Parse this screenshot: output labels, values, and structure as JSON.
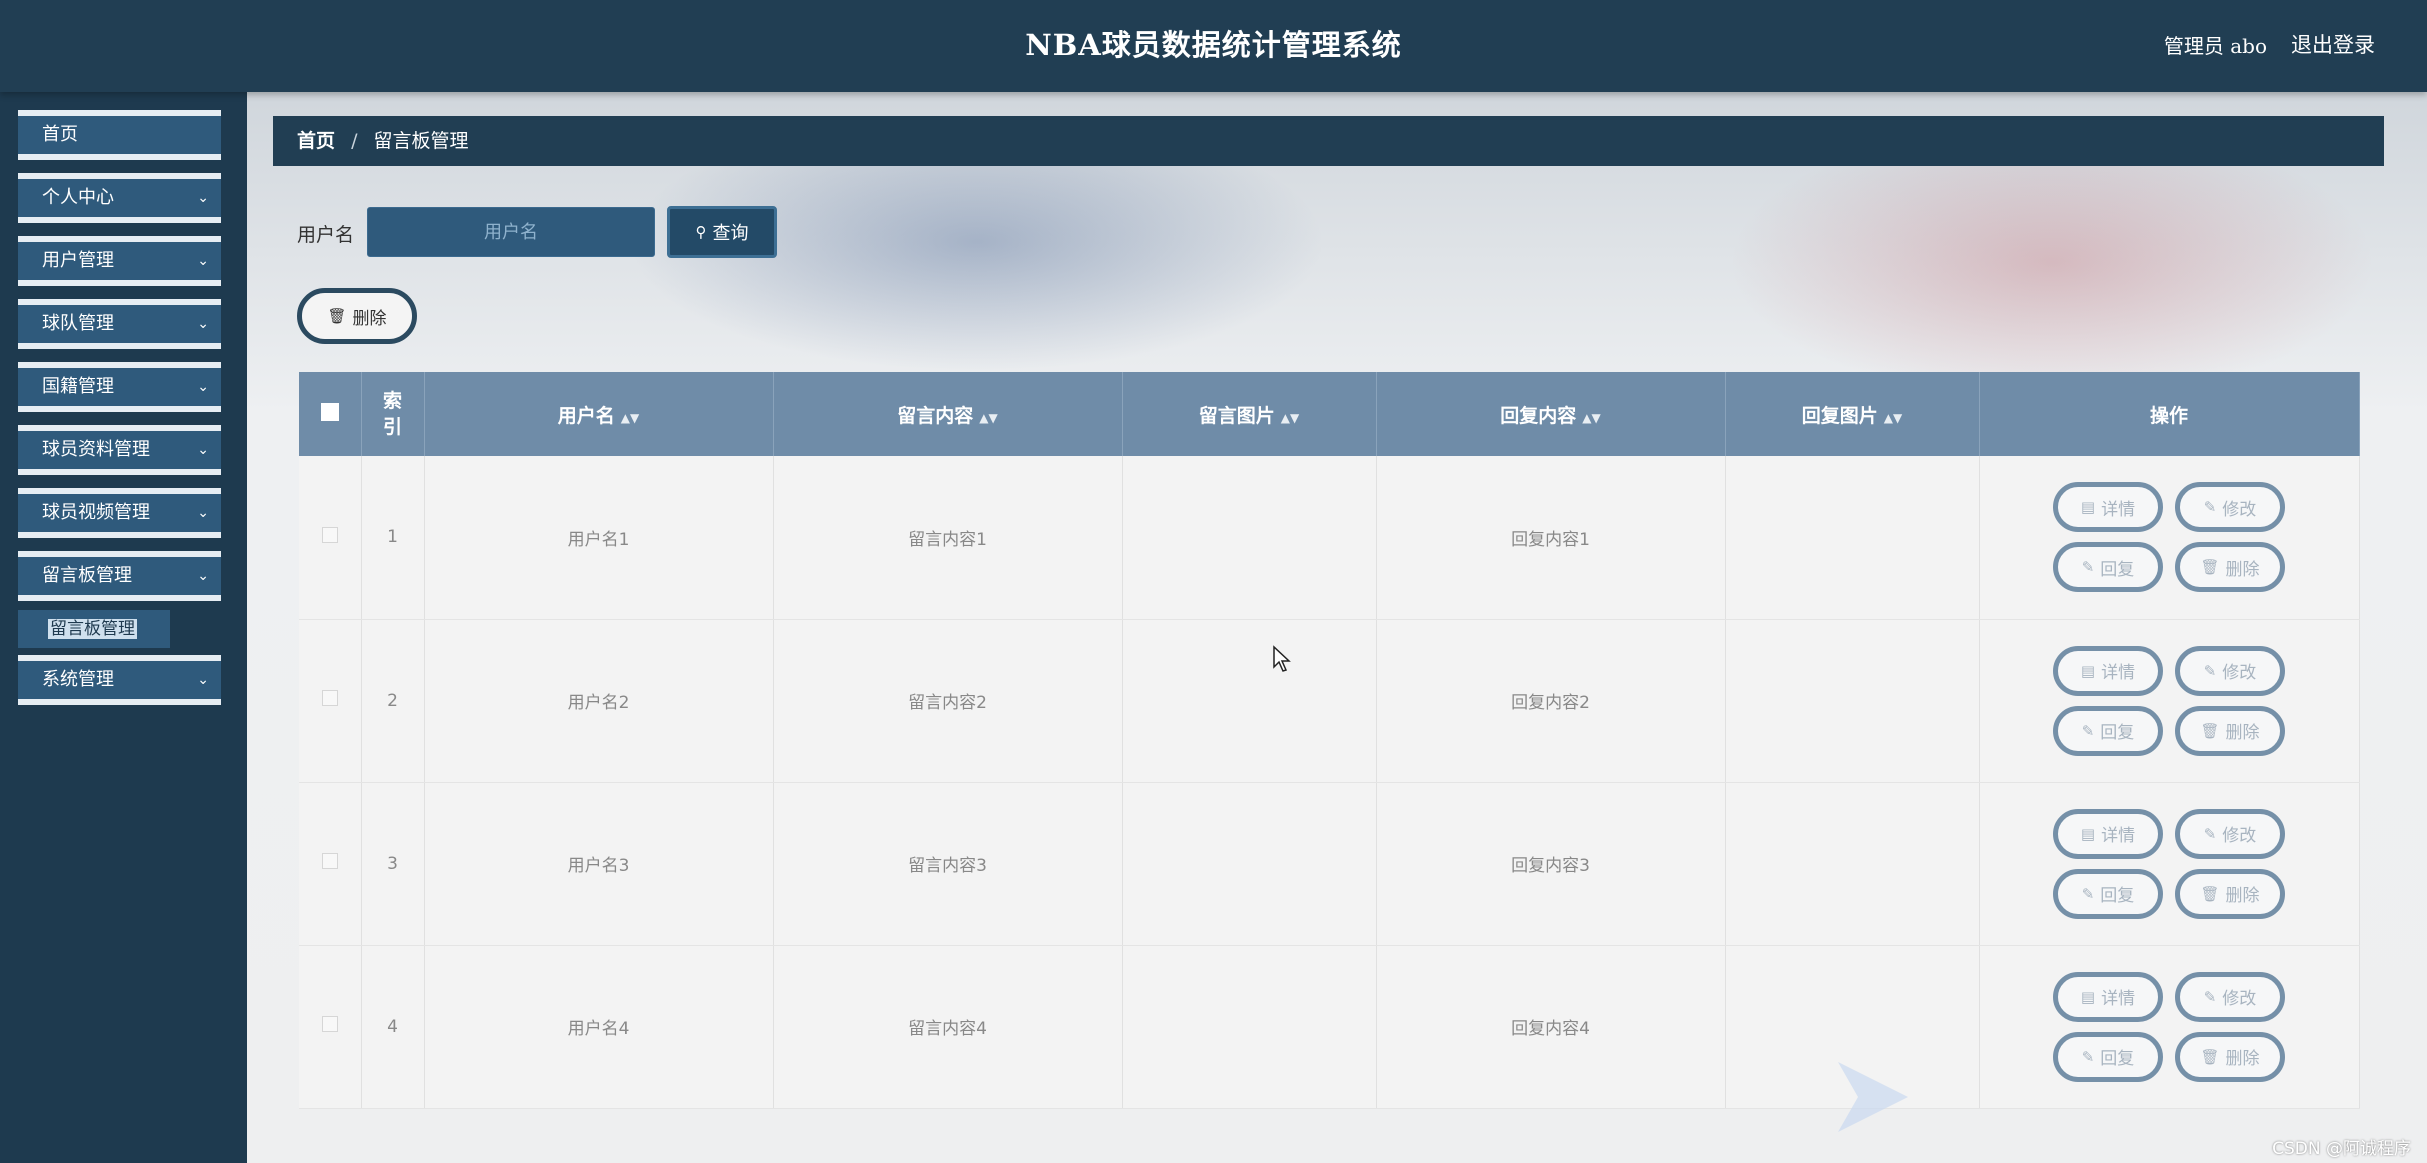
{
  "header": {
    "title": "NBA球员数据统计管理系统",
    "user": "管理员 abo",
    "logout": "退出登录"
  },
  "sidebar": {
    "items": [
      {
        "label": "首页",
        "expandable": false
      },
      {
        "label": "个人中心",
        "expandable": true
      },
      {
        "label": "用户管理",
        "expandable": true
      },
      {
        "label": "球队管理",
        "expandable": true
      },
      {
        "label": "国籍管理",
        "expandable": true
      },
      {
        "label": "球员资料管理",
        "expandable": true
      },
      {
        "label": "球员视频管理",
        "expandable": true
      },
      {
        "label": "留言板管理",
        "expandable": true
      },
      {
        "label": "系统管理",
        "expandable": true
      }
    ],
    "submenu": {
      "label": "留言板管理"
    }
  },
  "breadcrumb": {
    "home": "首页",
    "separator": "/",
    "current": "留言板管理"
  },
  "search": {
    "label": "用户名",
    "placeholder": "用户名",
    "button": "查询"
  },
  "toolbar": {
    "delete": "删除"
  },
  "table": {
    "headers": {
      "index": "索引",
      "username": "用户名",
      "message": "留言内容",
      "message_image": "留言图片",
      "reply": "回复内容",
      "reply_image": "回复图片",
      "actions": "操作"
    },
    "rows": [
      {
        "index": "1",
        "username": "用户名1",
        "message": "留言内容1",
        "message_image": "",
        "reply": "回复内容1",
        "reply_image": ""
      },
      {
        "index": "2",
        "username": "用户名2",
        "message": "留言内容2",
        "message_image": "",
        "reply": "回复内容2",
        "reply_image": ""
      },
      {
        "index": "3",
        "username": "用户名3",
        "message": "留言内容3",
        "message_image": "",
        "reply": "回复内容3",
        "reply_image": ""
      },
      {
        "index": "4",
        "username": "用户名4",
        "message": "留言内容4",
        "message_image": "",
        "reply": "回复内容4",
        "reply_image": ""
      }
    ],
    "row_actions": {
      "detail": "详情",
      "edit": "修改",
      "reply": "回复",
      "delete": "删除"
    }
  },
  "watermark": "CSDN @阿诚程序",
  "colors": {
    "header_bg": "#213e53",
    "sidebar_bg": "#1e3a4f",
    "menu_item_bg": "#2f5a7c",
    "table_header_bg": "#6f8ca8",
    "button_border": "#7590a8"
  }
}
